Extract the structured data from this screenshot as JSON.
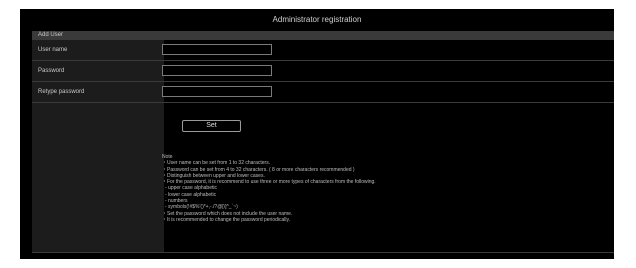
{
  "page": {
    "title": "Administrator registration"
  },
  "section": {
    "header": "Add User"
  },
  "fields": [
    {
      "label": "User name",
      "value": ""
    },
    {
      "label": "Password",
      "value": ""
    },
    {
      "label": "Retype password",
      "value": ""
    }
  ],
  "set_button": {
    "label": "Set"
  },
  "note": {
    "title": "Note",
    "lines": [
      "・User name can be set from 1 to 32 characters.",
      "・Password can be set from 4 to 32 characters. ( 8 or more characters recommended )",
      "・Distinguish between upper and lower cases.",
      "・For the password, it is recommend to use three or more types of characters from the following.",
      "- upper case alphabetic",
      "- lower case alphabetic",
      "- numbers",
      "- symbols(!#$%'()*+,-./?@[\\]^_`~)",
      "・Set the password which does not include the user name.",
      "・It is recommended to change the password periodically."
    ]
  }
}
